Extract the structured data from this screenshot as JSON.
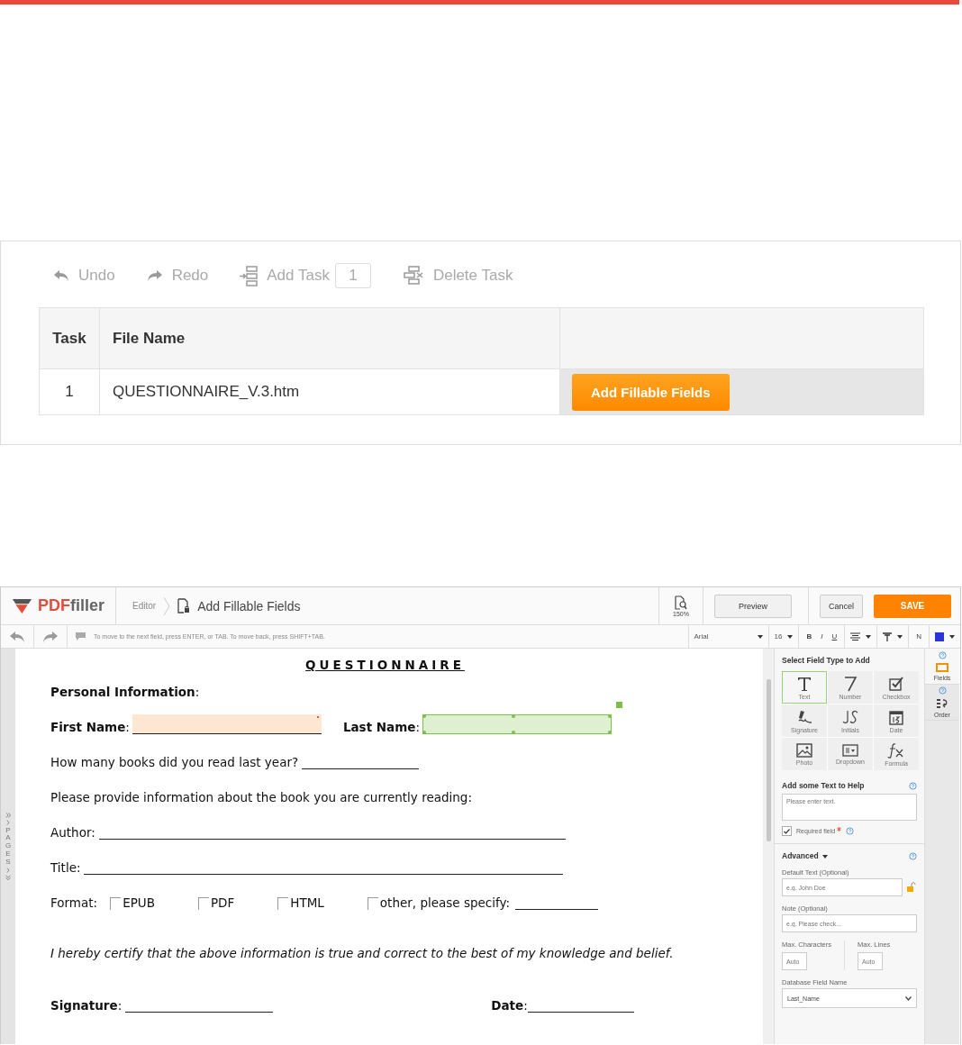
{
  "task_panel": {
    "toolbar": [
      {
        "kind": "undo",
        "label": "Undo"
      },
      {
        "kind": "redo",
        "label": "Redo"
      },
      {
        "kind": "add",
        "label": "Add Task"
      },
      {
        "kind": "delete",
        "label": "Delete Task"
      }
    ],
    "task_count": "1",
    "table": {
      "columns": [
        "Task",
        "File Name"
      ],
      "rows": [
        {
          "task": "1",
          "file_name": "QUESTIONNAIRE_V.3.htm",
          "action": "Add Fillable Fields"
        }
      ]
    }
  },
  "editor": {
    "logo": {
      "primary": "PDF",
      "secondary": "filler"
    },
    "breadcrumb": "Editor",
    "title": "Add Fillable Fields",
    "zoom": "150%",
    "buttons": [
      {
        "kind": "plain",
        "label": "Preview"
      },
      {
        "kind": "plain",
        "label": "Cancel"
      },
      {
        "kind": "primary",
        "label": "SAVE"
      }
    ],
    "hint": "To move to the next field, press ENTER, or TAB. To move back, press SHIFT+TAB.",
    "format": {
      "font": "Arial",
      "size": "16",
      "bold": "B",
      "italic": "I",
      "underline": "U",
      "text_type": "N"
    },
    "pages_label": "PAGES",
    "document": {
      "title": "QUESTIONNAIRE",
      "section": "**Personal Information**:",
      "fields": [
        {
          "label": "**First Name**:",
          "selected": false,
          "required": true
        },
        {
          "label": "**Last Name**:",
          "selected": true,
          "required": false
        }
      ],
      "books_question": "How many books did you read last year?",
      "book_prompt": "Please provide information about the book you are currently reading:",
      "author": "Author:",
      "title_label": "Title:",
      "format_label": "Format:",
      "formats": [
        {
          "label": "EPUB",
          "checked": false
        },
        {
          "label": "PDF",
          "checked": false
        },
        {
          "label": "HTML",
          "checked": false
        },
        {
          "label": "other, please specify:",
          "checked": false
        }
      ],
      "certification": "I hereby certify that the above information is true and correct to the best of my knowledge and belief.",
      "signature": "**Signature**:",
      "date": "**Date**:"
    },
    "panel": {
      "heading": "Select Field Type to Add",
      "field_types": [
        {
          "kind": "text",
          "label": "Text",
          "selected": true
        },
        {
          "kind": "number",
          "label": "Number",
          "selected": false
        },
        {
          "kind": "checkbox",
          "label": "Checkbox",
          "selected": false
        },
        {
          "kind": "signature",
          "label": "Signature",
          "selected": false
        },
        {
          "kind": "initials",
          "label": "Initials",
          "selected": false
        },
        {
          "kind": "date",
          "label": "Date",
          "selected": false
        },
        {
          "kind": "photo",
          "label": "Photo",
          "selected": false
        },
        {
          "kind": "dropdown",
          "label": "Dropdown",
          "selected": false
        },
        {
          "kind": "formula",
          "label": "Formula",
          "selected": false
        }
      ],
      "help_heading": "Add some Text to Help",
      "help_placeholder": "Please enter text.",
      "required": {
        "label": "Required field",
        "checked": true
      },
      "advanced": "Advanced",
      "default_text": {
        "label": "Default Text (Optional)",
        "placeholder": "e.g. John Doe"
      },
      "note": {
        "label": "Note (Optional)",
        "placeholder": "e.g. Please check..."
      },
      "max_characters": {
        "label": "Max. Characters",
        "placeholder": "Auto"
      },
      "max_lines": {
        "label": "Max. Lines",
        "placeholder": "Auto"
      },
      "database": {
        "label": "Database Field Name",
        "value": "Last_Name"
      }
    },
    "side_tabs": [
      {
        "kind": "fields",
        "label": "Fields",
        "selected": true
      },
      {
        "kind": "order",
        "label": "Order",
        "selected": false
      }
    ]
  }
}
